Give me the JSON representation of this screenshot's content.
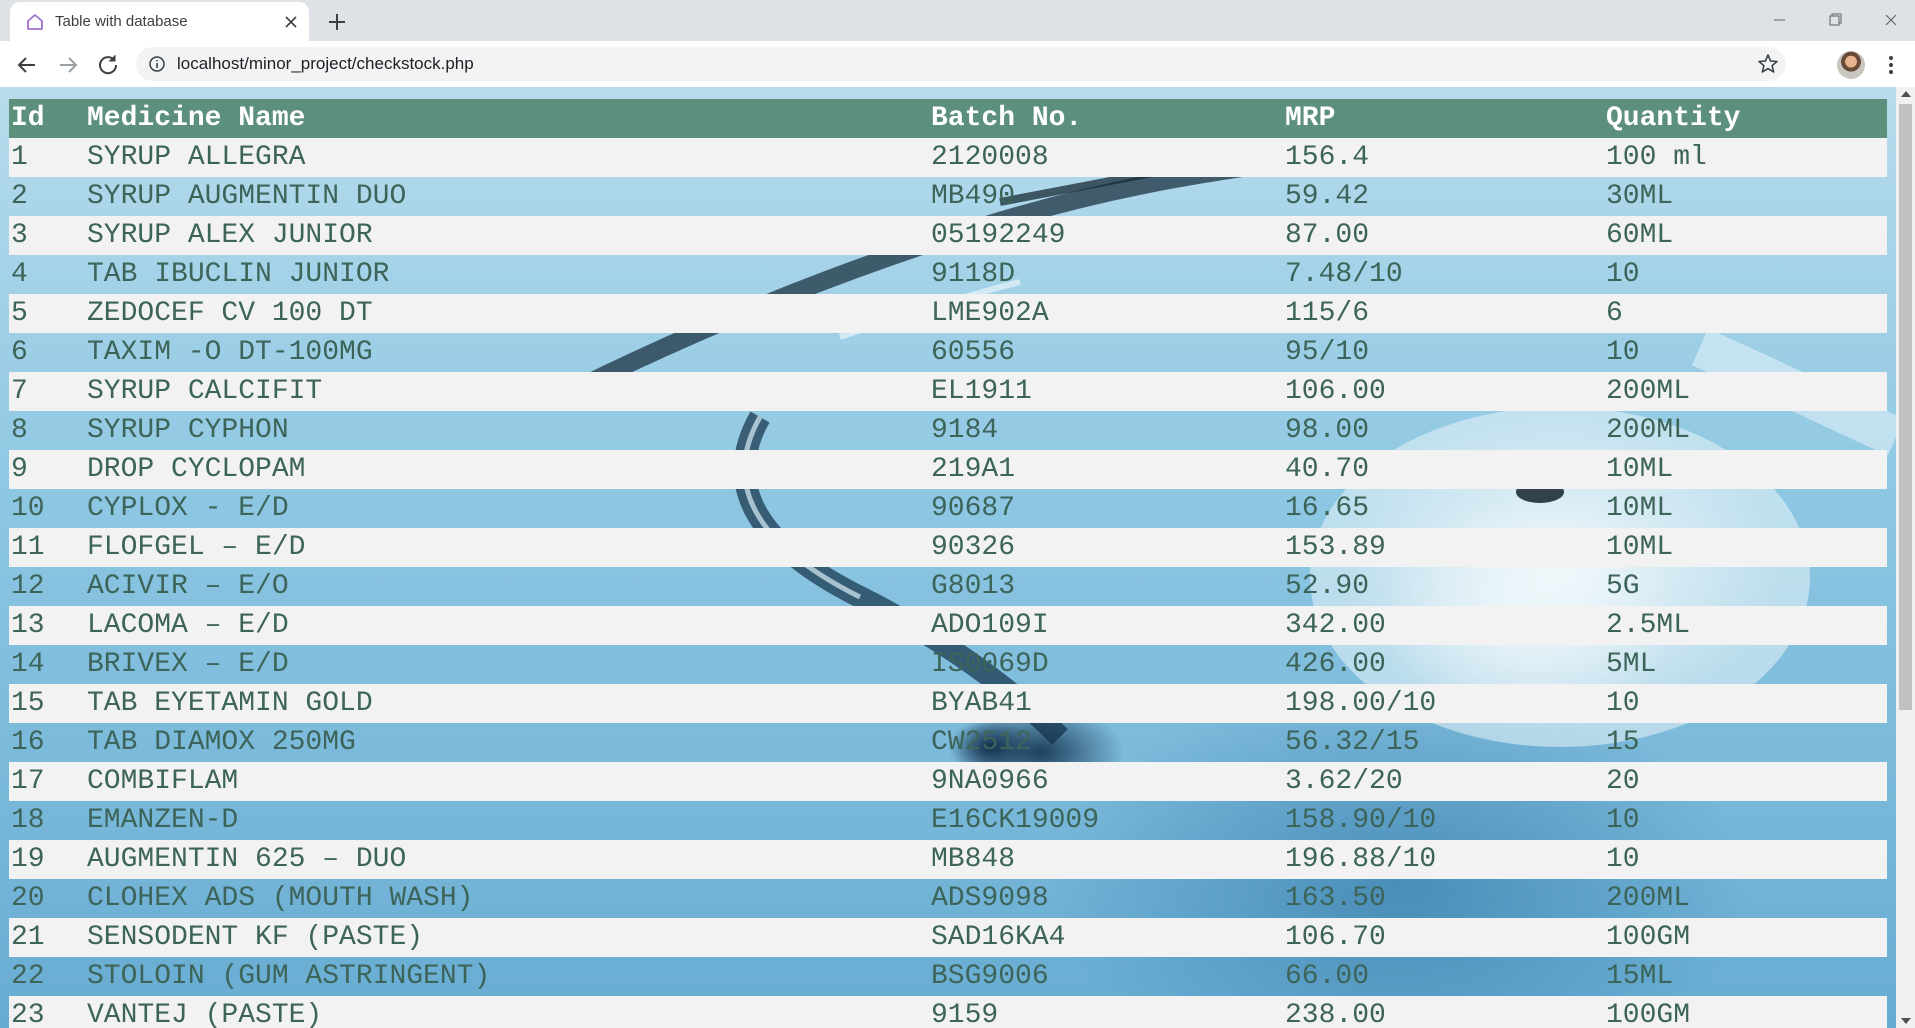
{
  "browser": {
    "tab_title": "Table with database",
    "url": "localhost/minor_project/checkstock.php"
  },
  "table": {
    "headers": [
      "Id",
      "Medicine Name",
      "Batch No.",
      "MRP",
      "Quantity"
    ],
    "rows": [
      [
        "1",
        "SYRUP ALLEGRA",
        "2120008",
        "156.4",
        "100 ml"
      ],
      [
        "2",
        "SYRUP AUGMENTIN DUO",
        "MB490",
        "59.42",
        "30ML"
      ],
      [
        "3",
        "SYRUP ALEX JUNIOR",
        "05192249",
        "87.00",
        "60ML"
      ],
      [
        "4",
        "TAB IBUCLIN JUNIOR",
        "9118D",
        "7.48/10",
        "10"
      ],
      [
        "5",
        "ZEDOCEF CV 100 DT",
        "LME902A",
        "115/6",
        "6"
      ],
      [
        "6",
        "TAXIM -O DT-100MG",
        "60556",
        "95/10",
        "10"
      ],
      [
        "7",
        "SYRUP CALCIFIT",
        "EL1911",
        "106.00",
        "200ML"
      ],
      [
        "8",
        "SYRUP CYPHON",
        "9184",
        "98.00",
        "200ML"
      ],
      [
        "9",
        "DROP CYCLOPAM",
        "219A1",
        "40.70",
        "10ML"
      ],
      [
        "10",
        "CYPLOX - E/D",
        "90687",
        "16.65",
        "10ML"
      ],
      [
        "11",
        "FLOFGEL – E/D",
        "90326",
        "153.89",
        "10ML"
      ],
      [
        "12",
        "ACIVIR – E/O",
        "G8013",
        "52.90",
        "5G"
      ],
      [
        "13",
        "LACOMA – E/D",
        "ADO109I",
        "342.00",
        "2.5ML"
      ],
      [
        "14",
        "BRIVEX – E/D",
        "IS0069D",
        "426.00",
        "5ML"
      ],
      [
        "15",
        "TAB EYETAMIN GOLD",
        "BYAB41",
        "198.00/10",
        "10"
      ],
      [
        "16",
        "TAB DIAMOX 250MG",
        "CW2512",
        "56.32/15",
        "15"
      ],
      [
        "17",
        "COMBIFLAM",
        "9NA0966",
        "3.62/20",
        "20"
      ],
      [
        "18",
        "EMANZEN-D",
        "E16CK19009",
        "158.90/10",
        "10"
      ],
      [
        "19",
        "AUGMENTIN 625 – DUO",
        "MB848",
        "196.88/10",
        "10"
      ],
      [
        "20",
        "CLOHEX ADS (MOUTH WASH)",
        "ADS9098",
        "163.50",
        "200ML"
      ],
      [
        "21",
        "SENSODENT KF (PASTE)",
        "SAD16KA4",
        "106.70",
        "100GM"
      ],
      [
        "22",
        "STOLOIN (GUM ASTRINGENT)",
        "BSG9006",
        "66.00",
        "15ML"
      ],
      [
        "23",
        "VANTEJ (PASTE)",
        "9159",
        "238.00",
        "100GM"
      ]
    ]
  }
}
